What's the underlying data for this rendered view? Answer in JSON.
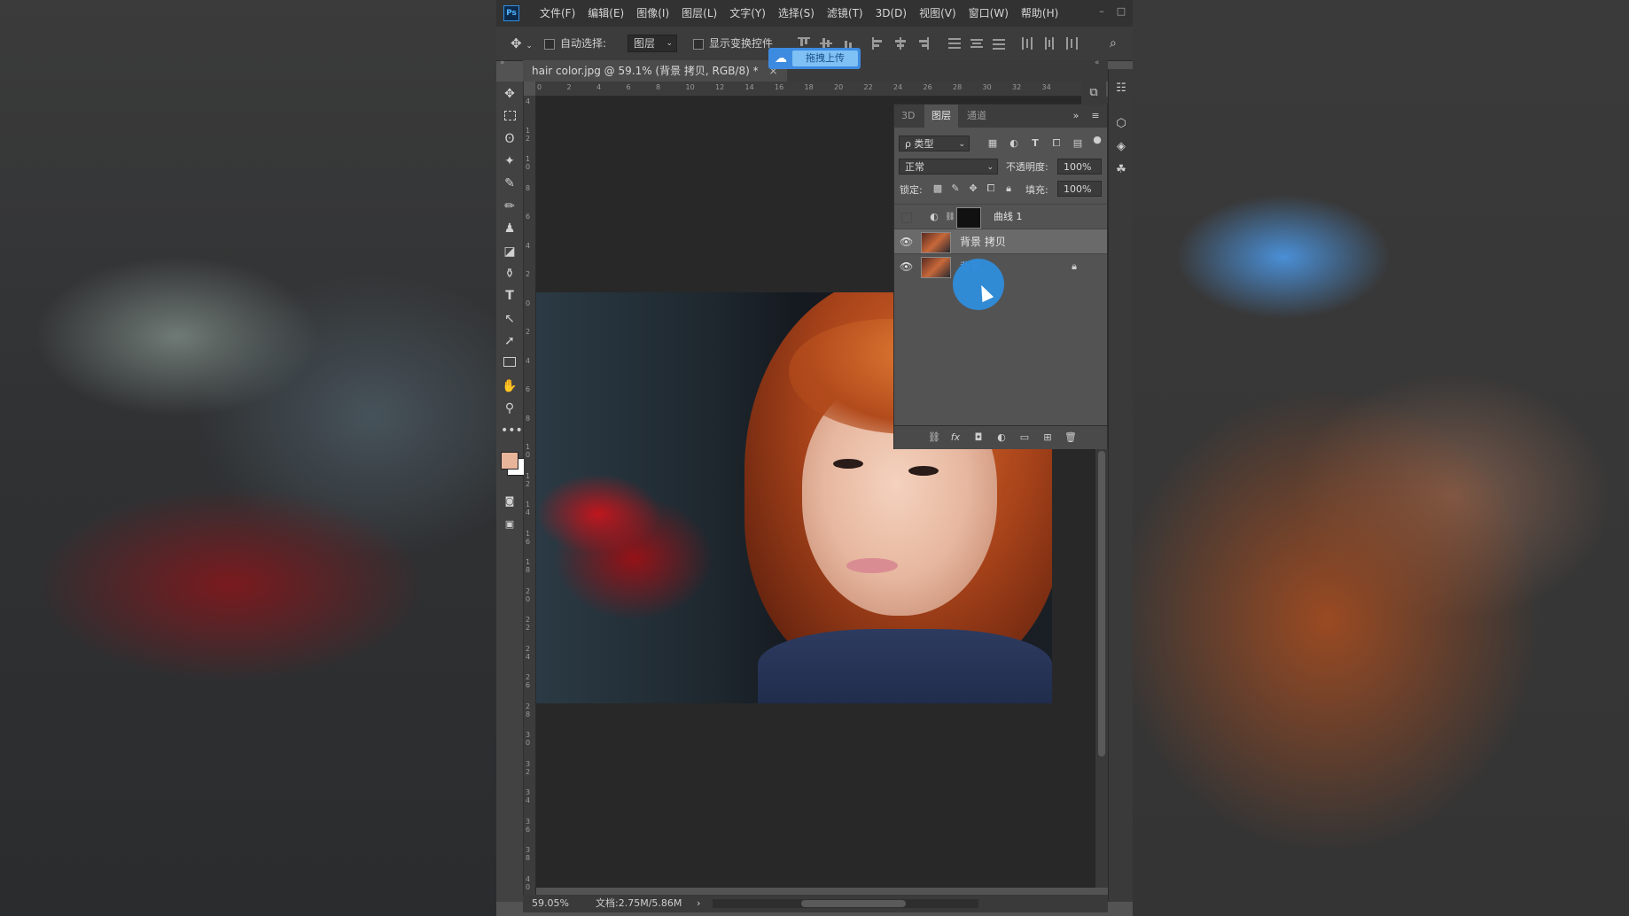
{
  "menubar": {
    "logo": "Ps",
    "items": [
      "文件(F)",
      "编辑(E)",
      "图像(I)",
      "图层(L)",
      "文字(Y)",
      "选择(S)",
      "滤镜(T)",
      "3D(D)",
      "视图(V)",
      "窗口(W)",
      "帮助(H)"
    ],
    "min_glyph": "–",
    "max_glyph": "□"
  },
  "options_bar": {
    "auto_select_label": "自动选择:",
    "auto_select_value": "图层",
    "show_transform_label": "显示变换控件"
  },
  "upload_chip": {
    "label": "拖拽上传"
  },
  "document": {
    "tab_title": "hair color.jpg @ 59.1% (背景 拷贝, RGB/8) *",
    "close_glyph": "×"
  },
  "ruler": {
    "h_ticks": [
      "0",
      "2",
      "4",
      "6",
      "8",
      "10",
      "12",
      "14",
      "16",
      "18",
      "20",
      "22",
      "24",
      "26",
      "28",
      "30",
      "32",
      "34"
    ],
    "v_ticks": [
      "4",
      "1 2",
      "1 0",
      "8",
      "6",
      "4",
      "2",
      "0",
      "2",
      "4",
      "6",
      "8",
      "1 0",
      "1 2",
      "1 4",
      "1 6",
      "1 8",
      "2 0",
      "2 2",
      "2 4",
      "2 6",
      "2 8",
      "3 0",
      "3 2",
      "3 4",
      "3 6",
      "3 8",
      "4 0"
    ]
  },
  "status_bar": {
    "zoom": "59.05%",
    "doc_info": "文档:2.75M/5.86M"
  },
  "layers_panel": {
    "tabs": [
      "3D",
      "图层",
      "通道"
    ],
    "filter_label": "ρ 类型",
    "blend_mode": "正常",
    "opacity_label": "不透明度:",
    "opacity_value": "100%",
    "lock_label": "锁定:",
    "fill_label": "填充:",
    "fill_value": "100%",
    "layers": [
      {
        "name": "曲线 1",
        "visible": false,
        "type": "adjustment"
      },
      {
        "name": "背景 拷贝",
        "visible": true,
        "type": "pixel",
        "selected": true
      },
      {
        "name": "背景",
        "visible": true,
        "type": "pixel",
        "locked": true
      }
    ]
  },
  "colors": {
    "accent": "#2f8ddb",
    "foreground_swatch": "#e8b49a",
    "background_swatch": "#ffffff"
  }
}
